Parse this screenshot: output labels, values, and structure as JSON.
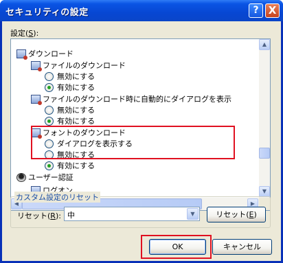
{
  "window": {
    "title": "セキュリティの設定",
    "help_glyph": "?",
    "close_glyph": "X"
  },
  "settings_label": "設定(",
  "settings_key": "S",
  "settings_end": "):",
  "tree": {
    "items": [
      {
        "kind": "category",
        "label": "ダウンロード",
        "icon": "download-settings-icon"
      },
      {
        "kind": "setting",
        "label": "ファイルのダウンロード",
        "icon": "download-settings-icon"
      },
      {
        "kind": "option",
        "label": "無効にする",
        "selected": false
      },
      {
        "kind": "option",
        "label": "有効にする",
        "selected": true
      },
      {
        "kind": "setting",
        "label": "ファイルのダウンロード時に自動的にダイアログを表示",
        "icon": "download-settings-icon"
      },
      {
        "kind": "option",
        "label": "無効にする",
        "selected": false
      },
      {
        "kind": "option",
        "label": "有効にする",
        "selected": true
      },
      {
        "kind": "setting",
        "label": "フォントのダウンロード",
        "icon": "download-settings-icon"
      },
      {
        "kind": "option",
        "label": "ダイアログを表示する",
        "selected": false
      },
      {
        "kind": "option",
        "label": "無効にする",
        "selected": false
      },
      {
        "kind": "option",
        "label": "有効にする",
        "selected": true
      },
      {
        "kind": "category",
        "label": "ユーザー認証",
        "icon": "user-auth-icon"
      },
      {
        "kind": "setting",
        "label": "ログオン",
        "icon": "download-settings-icon"
      }
    ]
  },
  "custom_reset": {
    "group_title": "カスタム設定のリセット",
    "reset_label": "リセット(",
    "reset_key": "R",
    "reset_end": "):",
    "selected_level": "中",
    "reset_button": "リセット(",
    "reset_button_key": "E",
    "reset_button_end": ")"
  },
  "buttons": {
    "ok": "OK",
    "cancel": "キャンセル"
  },
  "colors": {
    "highlight": "#e01020",
    "accent": "#0a54e4"
  }
}
